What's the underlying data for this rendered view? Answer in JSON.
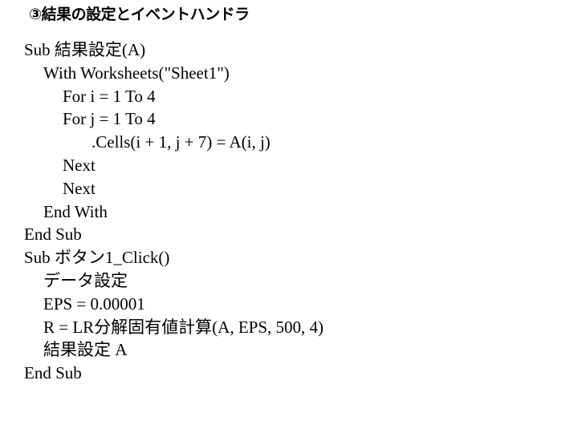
{
  "slide": {
    "title": "③結果の設定とイベントハンドラ"
  },
  "code": {
    "lines": [
      {
        "indent": 0,
        "text": "Sub 結果設定(A)"
      },
      {
        "indent": 1,
        "text": "With Worksheets(\"Sheet1\")"
      },
      {
        "indent": 2,
        "text": "For i = 1 To 4"
      },
      {
        "indent": 2,
        "text": "For j = 1 To 4"
      },
      {
        "indent": 3,
        "text": ".Cells(i + 1, j + 7) = A(i, j)"
      },
      {
        "indent": 2,
        "text": "Next"
      },
      {
        "indent": 2,
        "text": "Next"
      },
      {
        "indent": 1,
        "text": "End With"
      },
      {
        "indent": 0,
        "text": "End Sub"
      },
      {
        "indent": 0,
        "text": "Sub ボタン1_Click()"
      },
      {
        "indent": 1,
        "text": "データ設定"
      },
      {
        "indent": 1,
        "text": "EPS = 0.00001"
      },
      {
        "indent": 1,
        "text": "R = LR分解固有値計算(A, EPS, 500, 4)"
      },
      {
        "indent": 1,
        "text": "結果設定 A"
      },
      {
        "indent": 0,
        "text": "End Sub"
      }
    ]
  }
}
